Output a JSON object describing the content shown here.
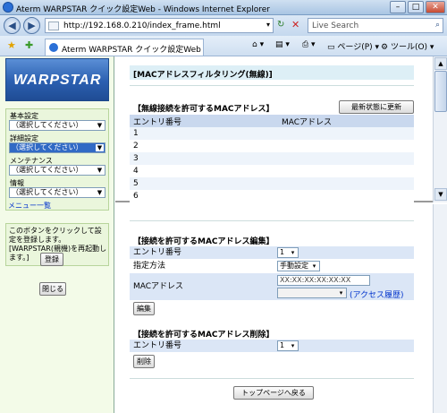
{
  "window": {
    "title": "Aterm WARPSTAR クイック設定Web - Windows Internet Explorer"
  },
  "addressbar": {
    "url": "http://192.168.0.210/index_frame.html",
    "search_placeholder": "Live Search"
  },
  "tabbar": {
    "tab_title": "Aterm WARPSTAR クイック設定Web",
    "page_menu": "ページ(P)",
    "tools_menu": "ツール(O)"
  },
  "sidebar": {
    "logo": "WARPSTAR",
    "basic_label": "基本設定",
    "basic_select": "（選択してください）",
    "detail_label": "詳細設定",
    "detail_select": "（選択してください）",
    "maint_label": "メンテナンス",
    "maint_select": "（選択してください）",
    "info_label": "情報",
    "info_select": "（選択してください）",
    "menu_list": "メニュー一覧",
    "note": "このボタンをクリックして設定を登録します。[WARPSTAR(親機)を再起動します。]",
    "register_button": "登録",
    "close_button": "閉じる"
  },
  "top": {
    "page_title": "[MACアドレスフィルタリング(無線)]",
    "section_title": "【無線接続を許可するMACアドレス】",
    "refresh_button": "最新状態に更新",
    "col_entry": "エントリ番号",
    "col_mac": "MACアドレス",
    "rows": [
      "1",
      "2",
      "3",
      "4",
      "5",
      "6"
    ]
  },
  "edit": {
    "title": "【接続を許可するMACアドレス編集】",
    "entry_label": "エントリ番号",
    "entry_value": "1",
    "method_label": "指定方法",
    "method_value": "手動設定",
    "mac_label": "MACアドレス",
    "mac_placeholder": "XX:XX:XX:XX:XX:XX",
    "history_link": "(アクセス履歴)",
    "edit_button": "編集"
  },
  "delete": {
    "title": "【接続を許可するMACアドレス削除】",
    "entry_label": "エントリ番号",
    "entry_value": "1",
    "delete_button": "削除"
  },
  "footer": {
    "top_button": "トップページへ戻る"
  }
}
